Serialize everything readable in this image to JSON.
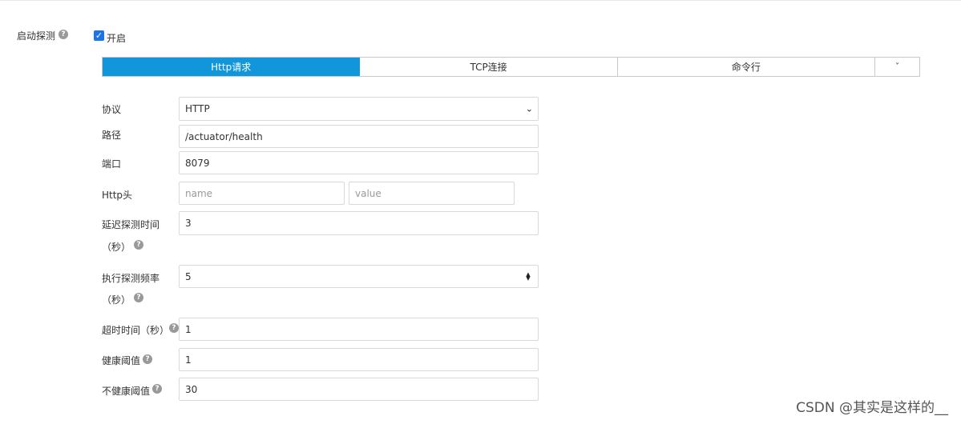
{
  "probe": {
    "label": "启动探测",
    "help_icon": "question-circle-icon",
    "enable_label": "开启",
    "enabled": true
  },
  "tabs": [
    {
      "label": "Http请求",
      "active": true
    },
    {
      "label": "TCP连接",
      "active": false
    },
    {
      "label": "命令行",
      "active": false
    },
    {
      "label": "˅",
      "active": false
    }
  ],
  "form": {
    "protocol": {
      "label": "协议",
      "value": "HTTP"
    },
    "path": {
      "label": "路径",
      "value": "/actuator/health"
    },
    "port": {
      "label": "端口",
      "value": "8079"
    },
    "http_header": {
      "label": "Http头",
      "name_placeholder": "name",
      "value_placeholder": "value"
    },
    "initial_delay": {
      "label_line1": "延迟探测时间",
      "label_line2": "（秒）",
      "value": "3"
    },
    "period": {
      "label_line1": "执行探测频率",
      "label_line2": "（秒）",
      "value": "5"
    },
    "timeout": {
      "label": "超时时间（秒）",
      "value": "1"
    },
    "success_threshold": {
      "label": "健康阈值",
      "value": "1"
    },
    "failure_threshold": {
      "label": "不健康阈值",
      "value": "30"
    }
  },
  "watermark": "CSDN @其实是这样的__",
  "colors": {
    "accent": "#1296db",
    "checkbox": "#1a73e8"
  }
}
